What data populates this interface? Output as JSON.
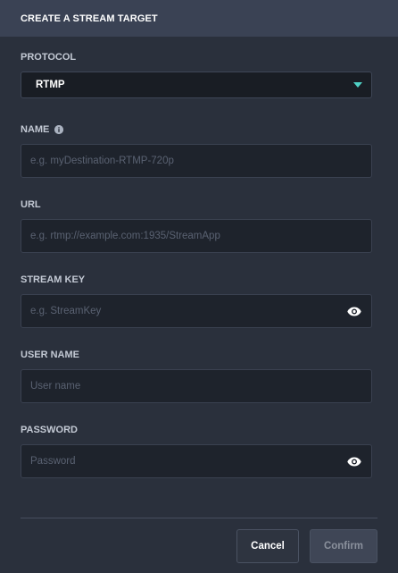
{
  "dialog": {
    "title": "CREATE A STREAM TARGET"
  },
  "protocol": {
    "label": "PROTOCOL",
    "value": "RTMP"
  },
  "name": {
    "label": "NAME",
    "placeholder": "e.g. myDestination-RTMP-720p"
  },
  "url": {
    "label": "URL",
    "placeholder": "e.g. rtmp://example.com:1935/StreamApp"
  },
  "stream_key": {
    "label": "STREAM KEY",
    "placeholder": "e.g. StreamKey"
  },
  "user_name": {
    "label": "USER NAME",
    "placeholder": "User name"
  },
  "password": {
    "label": "PASSWORD",
    "placeholder": "Password"
  },
  "buttons": {
    "cancel": "Cancel",
    "confirm": "Confirm"
  },
  "icons": {
    "info": "info-icon",
    "caret": "chevron-down-icon",
    "eye": "eye-icon"
  },
  "colors": {
    "accent": "#4fd1c5",
    "background": "#2a303c",
    "header": "#3a4254"
  }
}
